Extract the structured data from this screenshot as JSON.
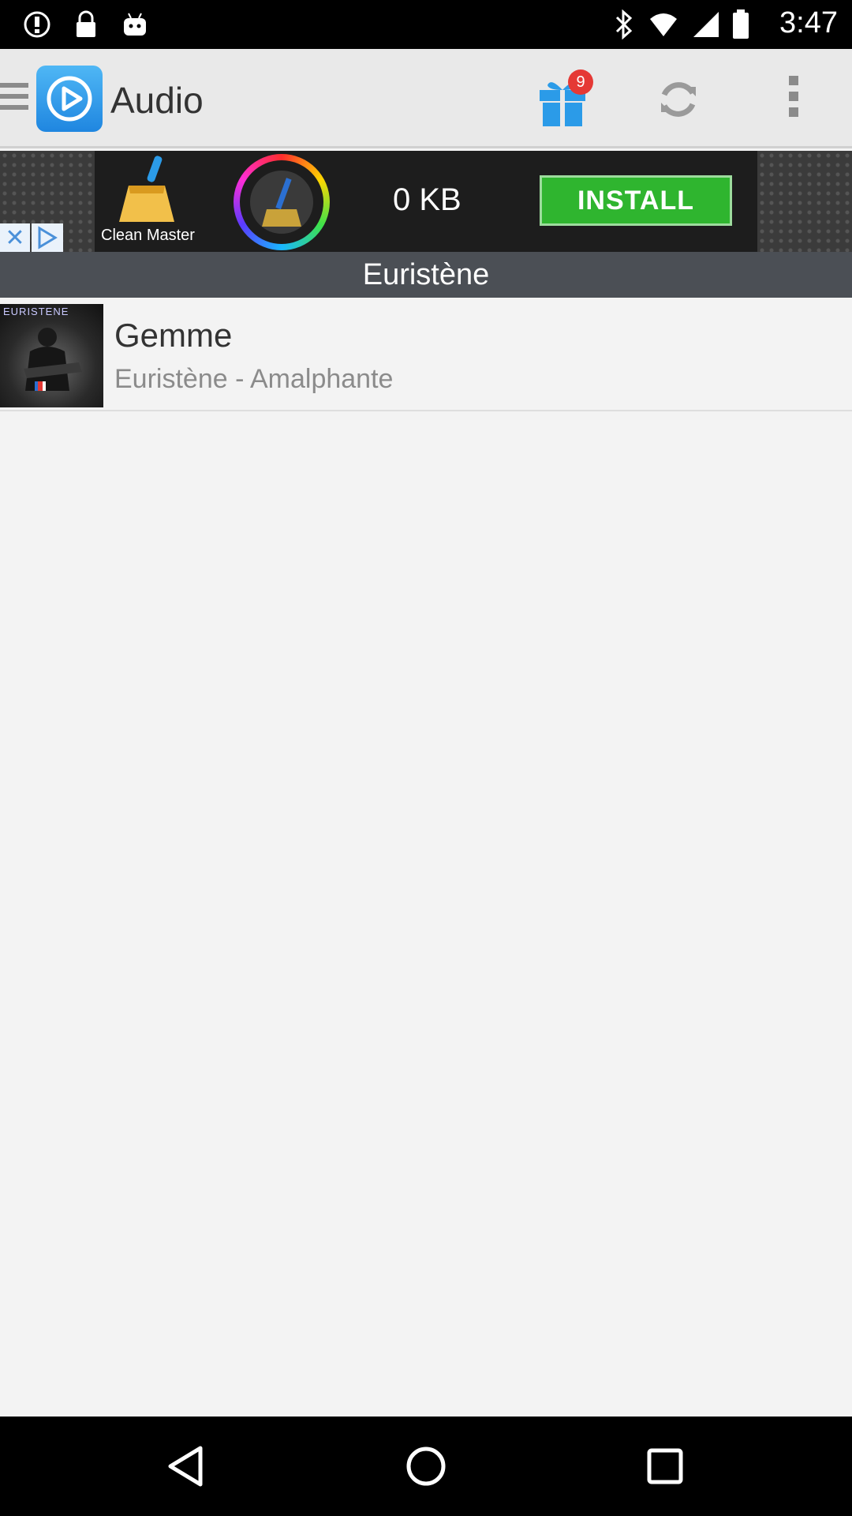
{
  "status_bar": {
    "time": "3:47",
    "icons": [
      "alert-icon",
      "lock-icon",
      "android-icon",
      "bluetooth-icon"
    ]
  },
  "app_bar": {
    "title": "Audio",
    "gift_badge_count": "9",
    "icons": [
      "menu-icon",
      "app-logo-play-icon",
      "gift-icon",
      "refresh-icon",
      "more-vert-icon"
    ]
  },
  "ad": {
    "app_name": "Clean Master",
    "size_text": "0 KB",
    "install_label": "INSTALL",
    "close_label": "✕",
    "colors": {
      "install_bg": "#2fb52f"
    }
  },
  "section": {
    "header": "Euristène"
  },
  "list": {
    "items": [
      {
        "title": "Gemme",
        "subtitle": "Euristène - Amalphante",
        "thumb_text": "EURISTENE"
      }
    ]
  },
  "nav_bar": {
    "icons": [
      "back-icon",
      "home-icon",
      "recents-icon"
    ]
  }
}
